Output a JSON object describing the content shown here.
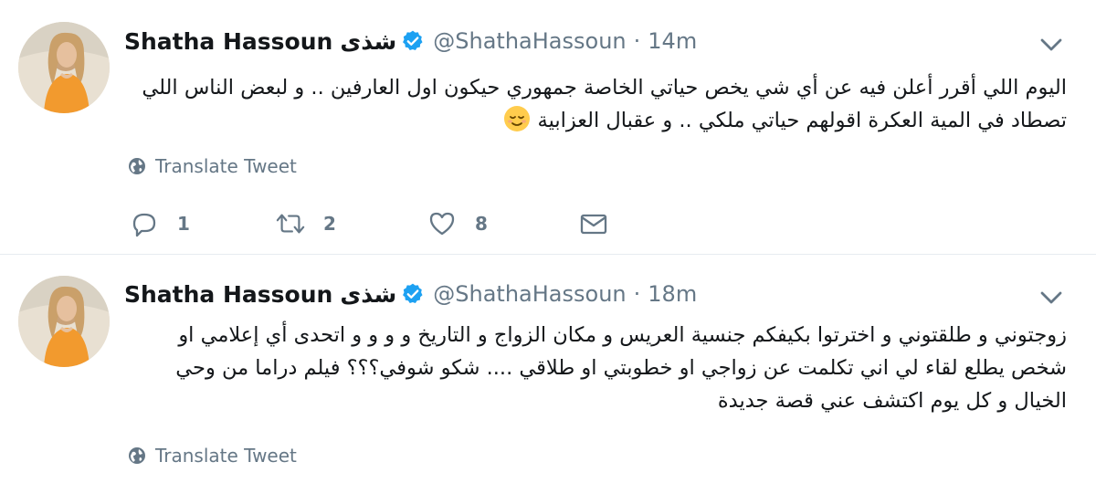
{
  "tweets": [
    {
      "display_name": "Shatha Hassoun",
      "display_name_ar": "شذى",
      "handle": "@ShathaHassoun",
      "separator": "·",
      "time": "14m",
      "text_lines": [
        "اليوم اللي أقرر أعلن فيه عن أي شي يخص حياتي الخاصة جمهوري حيكون اول العارفين .. و لبعض الناس اللي",
        "تصطاد في المية العكرة اقولهم حياتي ملكي .. و عقبال العزابية"
      ],
      "translate_label": "Translate Tweet",
      "reply_count": "1",
      "retweet_count": "2",
      "like_count": "8"
    },
    {
      "display_name": "Shatha Hassoun",
      "display_name_ar": "شذى",
      "handle": "@ShathaHassoun",
      "separator": "·",
      "time": "18m",
      "text_lines": [
        "زوجتوني و طلقتوني و اخترتوا بكيفكم جنسية العريس و مكان الزواج و التاريخ و و و و اتحدى أي إعلامي او",
        "شخص يطلع لقاء لي  اني تكلمت عن  زواجي او خطوبتي او طلاقي .... شكو شوفي؟؟؟ فيلم دراما من وحي",
        "الخيال و كل يوم اكتشف عني قصة جديدة"
      ],
      "translate_label": "Translate Tweet"
    }
  ],
  "colors": {
    "text": "#14171a",
    "muted": "#657786",
    "verified": "#1da1f2",
    "divider": "#e6ecf0"
  },
  "icons": [
    "verified-badge-icon",
    "chevron-down-icon",
    "globe-icon",
    "reply-icon",
    "retweet-icon",
    "like-icon",
    "direct-message-icon",
    "relieved-face-emoji"
  ]
}
